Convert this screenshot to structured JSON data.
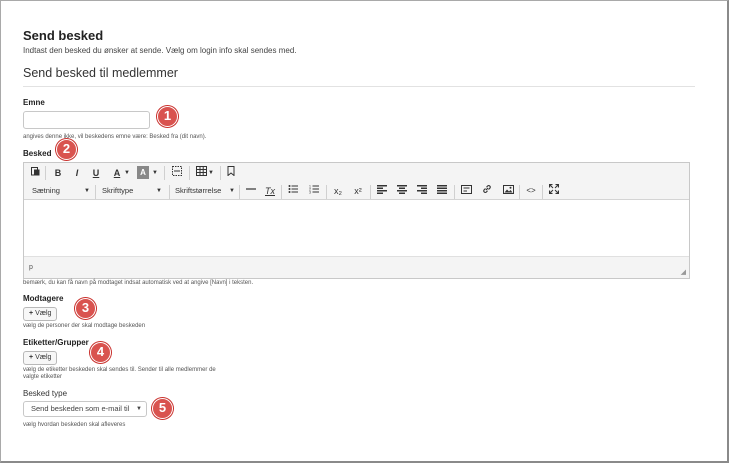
{
  "page": {
    "title": "Send besked",
    "subtitle": "Indtast den besked du ønsker at sende. Vælg om login info skal sendes med.",
    "section_title": "Send besked til medlemmer"
  },
  "subject": {
    "label": "Emne",
    "value": "",
    "help": "angives denne ikke, vil beskedens emne være: Besked fra (dit navn)."
  },
  "message": {
    "label": "Besked",
    "toolbar": {
      "format_label": "Sætning",
      "font_label": "Skrifttype",
      "size_label": "Skriftstørrelse",
      "bold": "B",
      "italic": "I",
      "underline": "U",
      "text_color": "A",
      "bg_color": "A",
      "clear_format": "Tx",
      "subscript": "x₂",
      "superscript": "x²",
      "code": "<>"
    },
    "status_path": "p",
    "help": "bemærk, du kan få navn på modtaget indsat automatisk ved at angive [Navn] i teksten."
  },
  "recipients": {
    "label": "Modtagere",
    "button_label": "Vælg",
    "help": "vælg de personer der skal modtage beskeden"
  },
  "tags": {
    "label": "Etiketter/Grupper",
    "button_label": "Vælg",
    "help_line1": "vælg de etiketter beskeden skal sendes til. Sender til alle medlemmer de",
    "help_line2": "valgte etiketter"
  },
  "message_type": {
    "label": "Besked type",
    "selected": "Send beskeden som e-mail til",
    "help": "vælg hvordan beskeden skal afleveres"
  },
  "markers": [
    "1",
    "2",
    "3",
    "4",
    "5"
  ],
  "colors": {
    "marker": "#d9534f"
  }
}
